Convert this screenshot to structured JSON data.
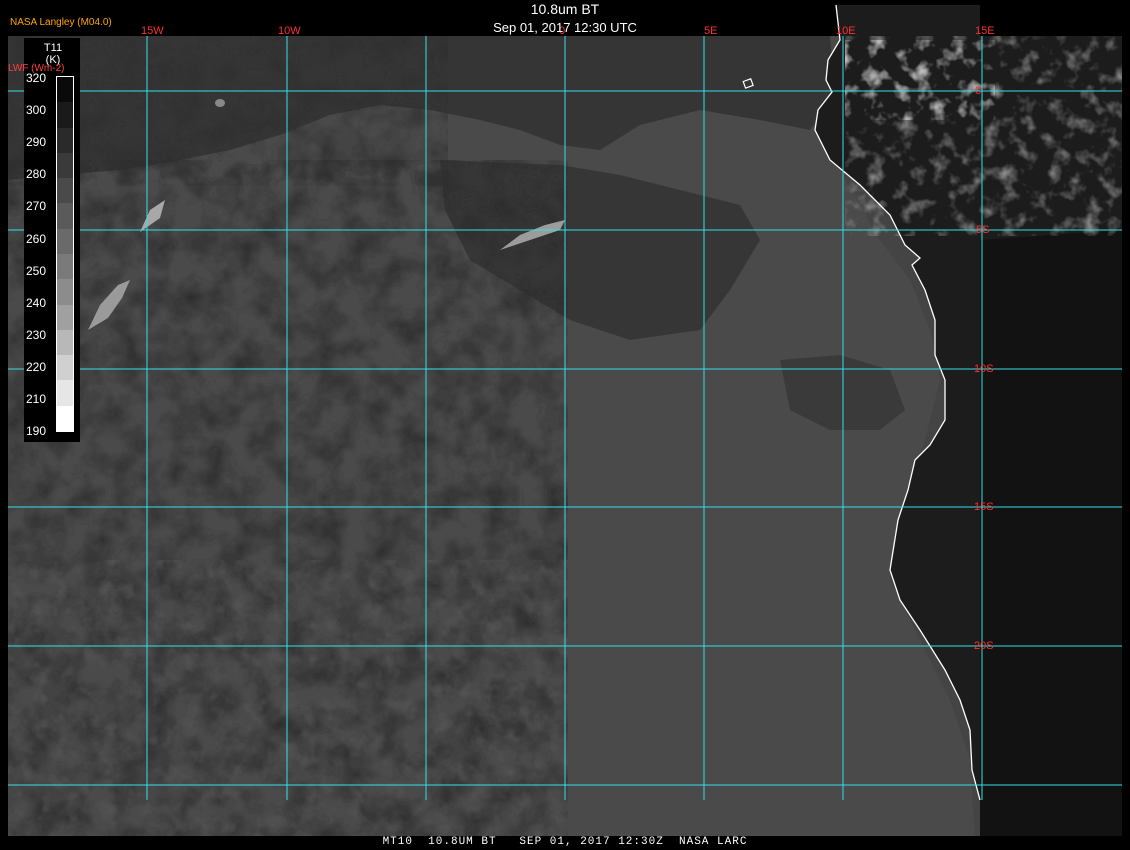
{
  "header": {
    "title": "10.8um BT",
    "subtitle": "Sep 01, 2017 12:30 UTC",
    "provider": "NASA Langley (M04.0)",
    "lwf_label": "LWF (Wm-2)"
  },
  "colorbar": {
    "title_line1": "T11",
    "title_line2": "(K)",
    "ticks": [
      "320",
      "300",
      "290",
      "280",
      "270",
      "260",
      "250",
      "240",
      "230",
      "220",
      "210",
      "190"
    ],
    "swatches": [
      "#0a0a0a",
      "#1a1a1a",
      "#2a2a2a",
      "#3a3a3a",
      "#4a4a4a",
      "#5a5a5a",
      "#6a6a6a",
      "#7a7a7a",
      "#8c8c8c",
      "#a0a0a0",
      "#b8b8b8",
      "#d0d0d0",
      "#e6e6e6",
      "#ffffff"
    ]
  },
  "grid": {
    "color": "#33e0e6",
    "label_color": "#ff3030",
    "longitude_labels": [
      "15W",
      "10W",
      "0",
      "5E",
      "10E",
      "15E"
    ],
    "latitude_labels": [
      "0",
      "5S",
      "10S",
      "15S",
      "20S"
    ]
  },
  "colors": {
    "ocean_base": "#4a4a4a",
    "cool_ocean": "#3c3c3c",
    "warm_patches": "#2d2d2d",
    "land_dark": "#1a1a1a",
    "cloud_bright": "#c8c8c8",
    "coastline": "#ffffff"
  },
  "footer": {
    "text": "MT10  10.8UM BT   SEP 01, 2017 12:30Z  NASA LARC"
  }
}
